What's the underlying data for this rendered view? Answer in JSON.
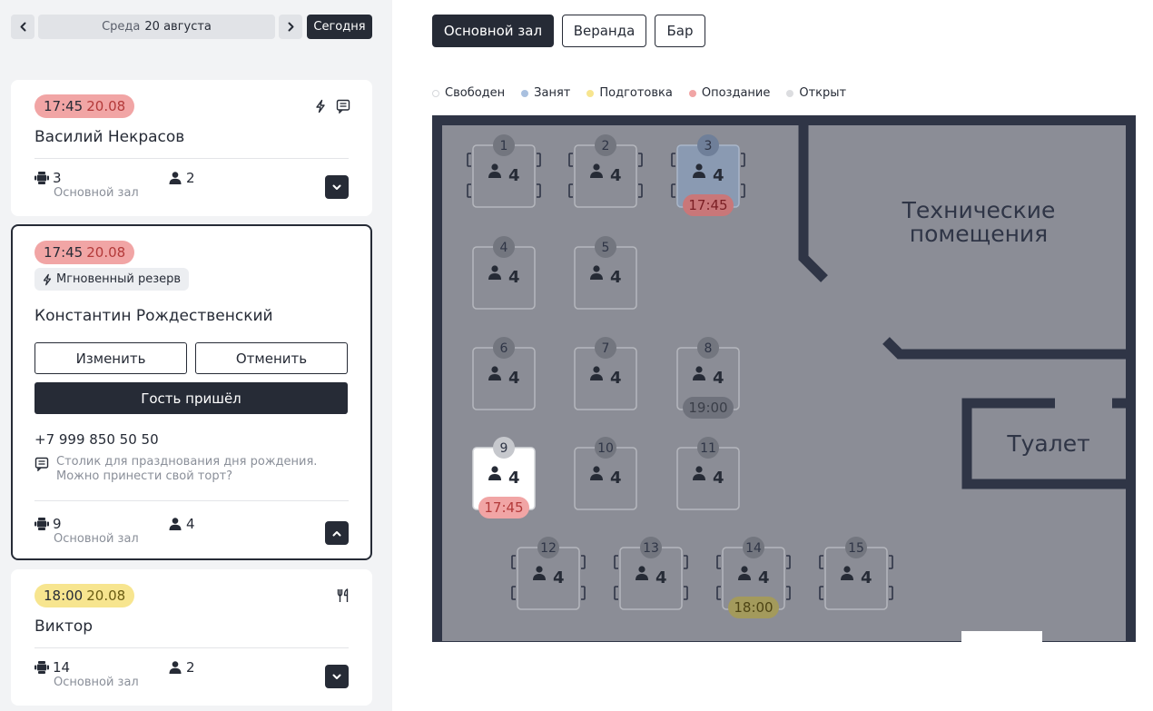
{
  "date_nav": {
    "weekday": "Среда",
    "date": "20 августа",
    "today_label": "Сегодня",
    "prev_icon": "chevron-left-icon",
    "next_icon": "chevron-right-icon"
  },
  "reservations": [
    {
      "time": "17:45",
      "date": "20.08",
      "status_color": "#f1a5a5",
      "name": "Василий Некрасов",
      "table": "3",
      "hall": "Основной зал",
      "guests": "2",
      "icons": [
        "lightning-icon",
        "comment-icon"
      ]
    },
    {
      "time": "17:45",
      "date": "20.08",
      "status_color": "#f1a5a5",
      "instant_label": "Мгновенный резерв",
      "name": "Константин Рождественский",
      "edit_label": "Изменить",
      "cancel_label": "Отменить",
      "arrived_label": "Гость пришёл",
      "phone": "+7 999 850 50 50",
      "comment": "Столик для празднования дня рождения. Можно принести свой торт?",
      "table": "9",
      "hall": "Основной зал",
      "guests": "4"
    },
    {
      "time": "18:00",
      "date": "20.08",
      "status_color": "#f7e58f",
      "name": "Виктор",
      "table": "14",
      "hall": "Основной зал",
      "guests": "2",
      "icons": [
        "fork-knife-icon"
      ]
    }
  ],
  "halls": [
    {
      "label": "Основной зал",
      "selected": true
    },
    {
      "label": "Веранда",
      "selected": false
    },
    {
      "label": "Бар",
      "selected": false
    }
  ],
  "legend": [
    {
      "label": "Свободен",
      "color": "#ffffff"
    },
    {
      "label": "Занят",
      "color": "#a9c0df"
    },
    {
      "label": "Подготовка",
      "color": "#f7e58f"
    },
    {
      "label": "Опоздание",
      "color": "#f1a5a5"
    },
    {
      "label": "Открыт",
      "color": "#dcdde0"
    }
  ],
  "floor_plan": {
    "rooms": [
      "Технические",
      "помещения",
      "Туалет"
    ],
    "tables": [
      {
        "number": "1",
        "seats": "4",
        "state": "default"
      },
      {
        "number": "2",
        "seats": "4",
        "state": "default"
      },
      {
        "number": "3",
        "seats": "4",
        "state": "occupied",
        "badge": "17:45",
        "badge_state": "late"
      },
      {
        "number": "4",
        "seats": "4",
        "state": "default"
      },
      {
        "number": "5",
        "seats": "4",
        "state": "default"
      },
      {
        "number": "6",
        "seats": "4",
        "state": "default"
      },
      {
        "number": "7",
        "seats": "4",
        "state": "default"
      },
      {
        "number": "8",
        "seats": "4",
        "state": "default",
        "badge": "19:00",
        "badge_state": "open"
      },
      {
        "number": "9",
        "seats": "4",
        "state": "selected",
        "badge": "17:45",
        "badge_state": "late-bright"
      },
      {
        "number": "10",
        "seats": "4",
        "state": "default"
      },
      {
        "number": "11",
        "seats": "4",
        "state": "default"
      },
      {
        "number": "12",
        "seats": "4",
        "state": "default"
      },
      {
        "number": "13",
        "seats": "4",
        "state": "default"
      },
      {
        "number": "14",
        "seats": "4",
        "state": "default",
        "badge": "18:00",
        "badge_state": "prep"
      },
      {
        "number": "15",
        "seats": "4",
        "state": "default"
      }
    ]
  }
}
